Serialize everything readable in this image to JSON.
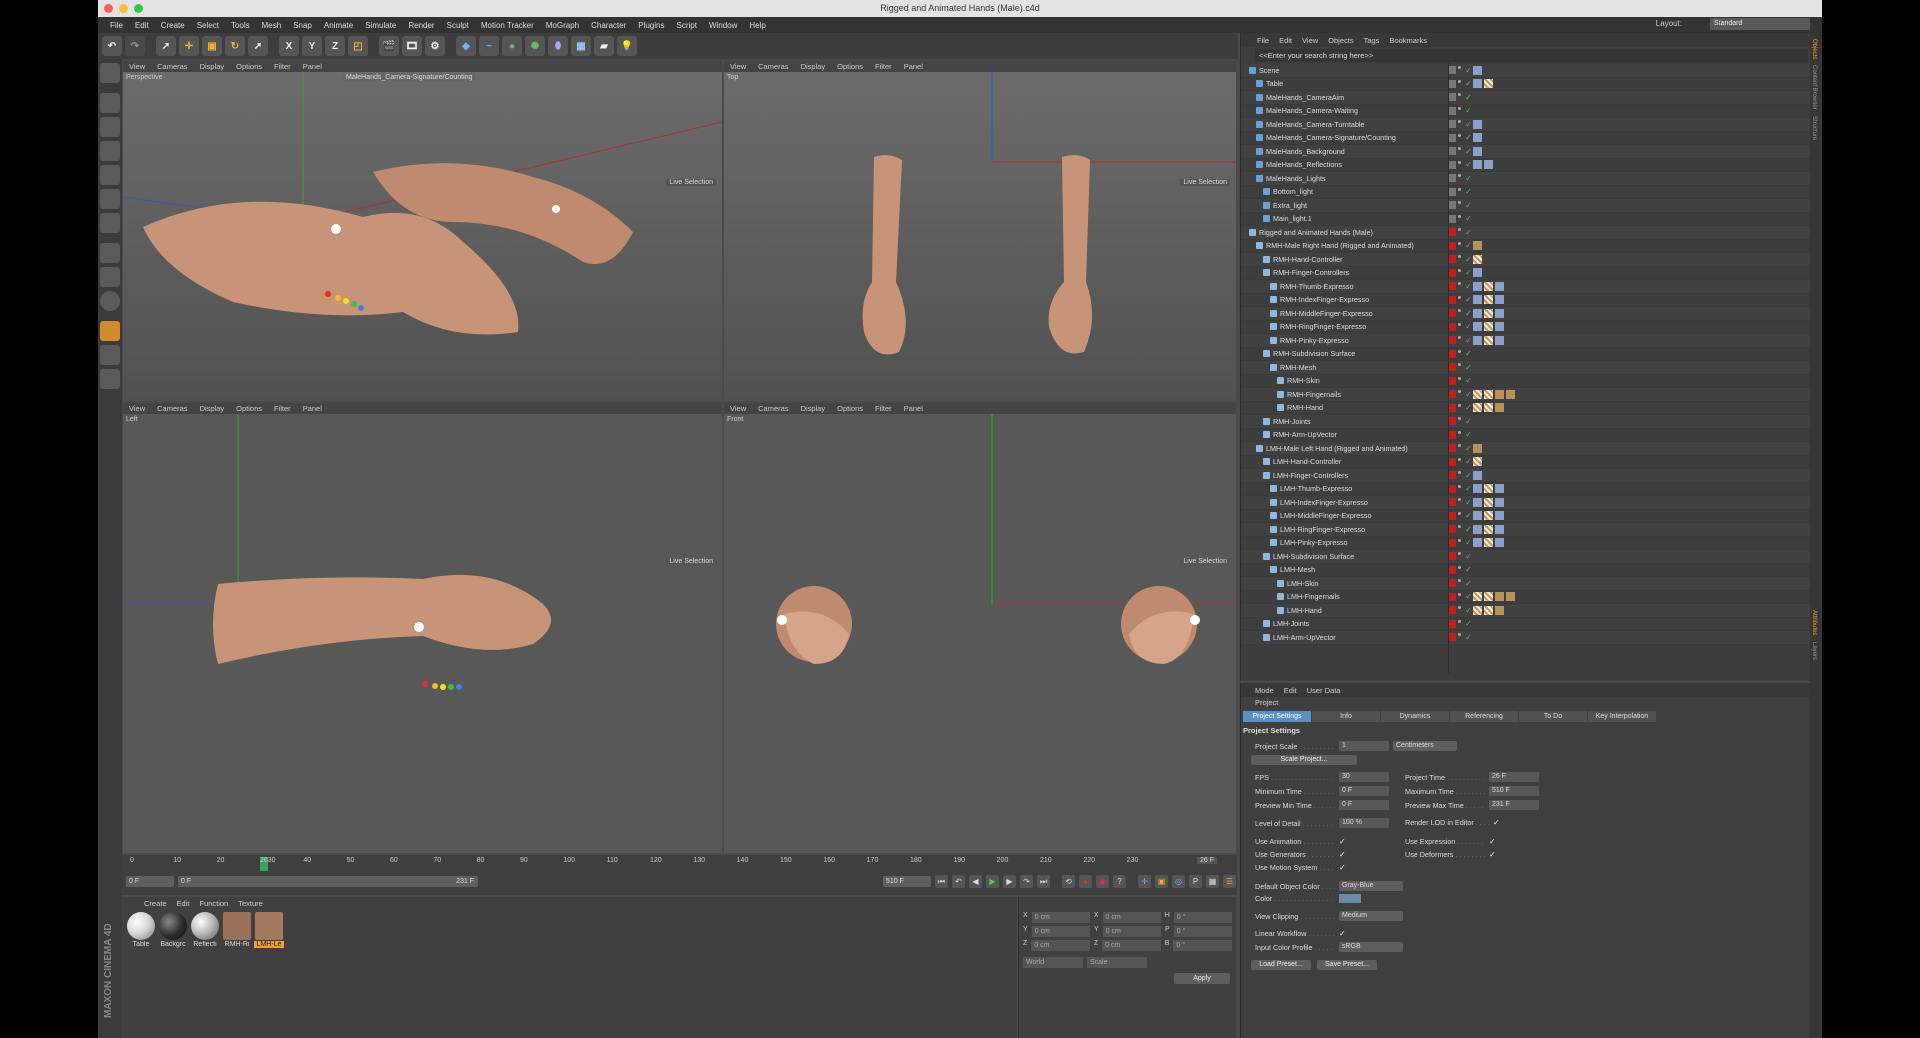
{
  "window": {
    "title": "Rigged and Animated Hands (Male).c4d"
  },
  "menu": [
    "File",
    "Edit",
    "Create",
    "Select",
    "Tools",
    "Mesh",
    "Snap",
    "Animate",
    "Simulate",
    "Render",
    "Sculpt",
    "Motion Tracker",
    "MoGraph",
    "Character",
    "Plugins",
    "Script",
    "Window",
    "Help"
  ],
  "layout": {
    "label": "Layout:",
    "value": "Standard"
  },
  "toolbar": {
    "axes": [
      "X",
      "Y",
      "Z"
    ]
  },
  "viewport_menu": [
    "View",
    "Cameras",
    "Display",
    "Options",
    "Filter",
    "Panel"
  ],
  "viewports": {
    "perspective": {
      "name": "Perspective",
      "camera": "MaleHands_Camera-Signature/Counting",
      "live": "Live Selection"
    },
    "top": {
      "name": "Top",
      "live": "Live Selection"
    },
    "left": {
      "name": "Left",
      "live": "Live Selection"
    },
    "front": {
      "name": "Front",
      "live": "Live Selection"
    }
  },
  "timeline": {
    "ticks": [
      "0",
      "10",
      "20",
      "2630",
      "40",
      "50",
      "60",
      "70",
      "80",
      "90",
      "100",
      "110",
      "120",
      "130",
      "140",
      "150",
      "160",
      "170",
      "180",
      "190",
      "200",
      "210",
      "220",
      "230"
    ],
    "current_frame": "26 F",
    "start": "0 F",
    "range_start": "0 F",
    "range_end": "231 F",
    "end": "510 F"
  },
  "materials": {
    "menu": [
      "Create",
      "Edit",
      "Function",
      "Texture"
    ],
    "items": [
      {
        "label": "Table",
        "color": "#d8d8d8"
      },
      {
        "label": "Backgrc",
        "color": "#2a2a2a"
      },
      {
        "label": "Reflecti",
        "color": "#bbbbbb"
      },
      {
        "label": "RMH-Ri",
        "color": "#9a7058"
      },
      {
        "label": "LMH-Le",
        "color": "#a37a60"
      }
    ]
  },
  "coords": {
    "rows": [
      [
        "X",
        "0 cm",
        "X",
        "0 cm",
        "H",
        "0 °"
      ],
      [
        "Y",
        "0 cm",
        "Y",
        "0 cm",
        "P",
        "0 °"
      ],
      [
        "Z",
        "0 cm",
        "Z",
        "0 cm",
        "B",
        "0 °"
      ]
    ],
    "mode1": "World",
    "mode2": "Scale",
    "apply": "Apply"
  },
  "object_manager": {
    "menu": [
      "File",
      "Edit",
      "View",
      "Objects",
      "Tags",
      "Bookmarks"
    ],
    "search": "<<Enter your search string here>>",
    "objects": [
      {
        "name": "Scene",
        "indent": 0,
        "red": false,
        "tags": "b"
      },
      {
        "name": "Table",
        "indent": 1,
        "red": false,
        "tags": "bc"
      },
      {
        "name": "MaleHands_CameraAim",
        "indent": 1,
        "red": false,
        "tags": ""
      },
      {
        "name": "MaleHands_Camera-Waiting",
        "indent": 1,
        "red": false,
        "tags": ""
      },
      {
        "name": "MaleHands_Camera-Turntable",
        "indent": 1,
        "red": false,
        "tags": "b"
      },
      {
        "name": "MaleHands_Camera-Signature/Counting",
        "indent": 1,
        "red": false,
        "tags": "b"
      },
      {
        "name": "MaleHands_Background",
        "indent": 1,
        "red": false,
        "tags": "b"
      },
      {
        "name": "MaleHands_Reflections",
        "indent": 1,
        "red": false,
        "tags": "bb"
      },
      {
        "name": "MaleHands_Lights",
        "indent": 1,
        "red": false,
        "tags": ""
      },
      {
        "name": "Bottom_light",
        "indent": 2,
        "red": false,
        "tags": ""
      },
      {
        "name": "Extra_light",
        "indent": 2,
        "red": false,
        "tags": ""
      },
      {
        "name": "Main_light.1",
        "indent": 2,
        "red": false,
        "tags": ""
      },
      {
        "name": "Rigged and Animated Hands (Male)",
        "indent": 0,
        "red": true,
        "tags": ""
      },
      {
        "name": "RMH-Male Right Hand (Rigged and Animated)",
        "indent": 1,
        "red": true,
        "tags": "a"
      },
      {
        "name": "RMH-Hand-Controller",
        "indent": 2,
        "red": true,
        "tags": "c"
      },
      {
        "name": "RMH-Finger-Controllers",
        "indent": 2,
        "red": true,
        "tags": "b"
      },
      {
        "name": "RMH-Thumb-Expresso",
        "indent": 3,
        "red": true,
        "tags": "bcb"
      },
      {
        "name": "RMH-IndexFinger-Expresso",
        "indent": 3,
        "red": true,
        "tags": "bcb"
      },
      {
        "name": "RMH-MiddleFinger-Expresso",
        "indent": 3,
        "red": true,
        "tags": "bcb"
      },
      {
        "name": "RMH-RingFinger-Expresso",
        "indent": 3,
        "red": true,
        "tags": "bcb"
      },
      {
        "name": "RMH-Pinky-Expresso",
        "indent": 3,
        "red": true,
        "tags": "bcb"
      },
      {
        "name": "RMH-Subdivision Surface",
        "indent": 2,
        "red": true,
        "tags": ""
      },
      {
        "name": "RMH-Mesh",
        "indent": 3,
        "red": true,
        "tags": ""
      },
      {
        "name": "RMH-Skin",
        "indent": 4,
        "red": true,
        "tags": ""
      },
      {
        "name": "RMH-Fingernails",
        "indent": 4,
        "red": true,
        "tags": "ccaa"
      },
      {
        "name": "RMH-Hand",
        "indent": 4,
        "red": true,
        "tags": "cca"
      },
      {
        "name": "RMH-Joints",
        "indent": 2,
        "red": true,
        "tags": ""
      },
      {
        "name": "RMH-Arm-UpVector",
        "indent": 2,
        "red": true,
        "tags": ""
      },
      {
        "name": "LMH-Male Left Hand (Rigged and Animated)",
        "indent": 1,
        "red": true,
        "tags": "a"
      },
      {
        "name": "LMH-Hand-Controller",
        "indent": 2,
        "red": true,
        "tags": "c"
      },
      {
        "name": "LMH-Finger-Controllers",
        "indent": 2,
        "red": true,
        "tags": "b"
      },
      {
        "name": "LMH-Thumb-Expresso",
        "indent": 3,
        "red": true,
        "tags": "bcb"
      },
      {
        "name": "LMH-IndexFinger-Expresso",
        "indent": 3,
        "red": true,
        "tags": "bcb"
      },
      {
        "name": "LMH-MiddleFinger-Expresso",
        "indent": 3,
        "red": true,
        "tags": "bcb"
      },
      {
        "name": "LMH-RingFinger-Expresso",
        "indent": 3,
        "red": true,
        "tags": "bcb"
      },
      {
        "name": "LMH-Pinky-Expresso",
        "indent": 3,
        "red": true,
        "tags": "bcb"
      },
      {
        "name": "LMH-Subdivision Surface",
        "indent": 2,
        "red": true,
        "tags": ""
      },
      {
        "name": "LMH-Mesh",
        "indent": 3,
        "red": true,
        "tags": ""
      },
      {
        "name": "LMH-Skin",
        "indent": 4,
        "red": true,
        "tags": ""
      },
      {
        "name": "LMH-Fingernails",
        "indent": 4,
        "red": true,
        "tags": "ccaa"
      },
      {
        "name": "LMH-Hand",
        "indent": 4,
        "red": true,
        "tags": "cca"
      },
      {
        "name": "LMH-Joints",
        "indent": 2,
        "red": true,
        "tags": ""
      },
      {
        "name": "LMH-Arm-UpVector",
        "indent": 2,
        "red": true,
        "tags": ""
      }
    ]
  },
  "attributes": {
    "menu": [
      "Mode",
      "Edit",
      "User Data"
    ],
    "object": "Project",
    "tabs": [
      "Project Settings",
      "Info",
      "Dynamics",
      "Referencing",
      "To Do",
      "Key Interpolation"
    ],
    "section": "Project Settings",
    "project_scale": {
      "label": "Project Scale",
      "value": "1",
      "unit": "Centimeters"
    },
    "scale_project": "Scale Project...",
    "fps": {
      "label": "FPS",
      "value": "30"
    },
    "project_time": {
      "label": "Project Time",
      "value": "26 F"
    },
    "min_time": {
      "label": "Minimum Time",
      "value": "0 F"
    },
    "max_time": {
      "label": "Maximum Time",
      "value": "510 F"
    },
    "prev_min": {
      "label": "Preview Min Time",
      "value": "0 F"
    },
    "prev_max": {
      "label": "Preview Max Time",
      "value": "231 F"
    },
    "lod": {
      "label": "Level of Detail",
      "value": "100 %"
    },
    "render_lod": "Render LOD in Editor",
    "use_animation": "Use Animation",
    "use_expression": "Use Expression",
    "use_generators": "Use Generators",
    "use_deformers": "Use Deformers",
    "use_motion": "Use Motion System",
    "default_color": {
      "label": "Default Object Color",
      "value": "Gray-Blue"
    },
    "color": "Color",
    "view_clipping": {
      "label": "View Clipping",
      "value": "Medium"
    },
    "linear_workflow": "Linear Workflow",
    "input_profile": {
      "label": "Input Color Profile",
      "value": "sRGB"
    },
    "load_preset": "Load Preset...",
    "save_preset": "Save Preset..."
  },
  "right_strip": [
    "Objects",
    "Content Browser",
    "Structure",
    "Attributes",
    "Layers"
  ],
  "brand": "MAXON CINEMA 4D"
}
